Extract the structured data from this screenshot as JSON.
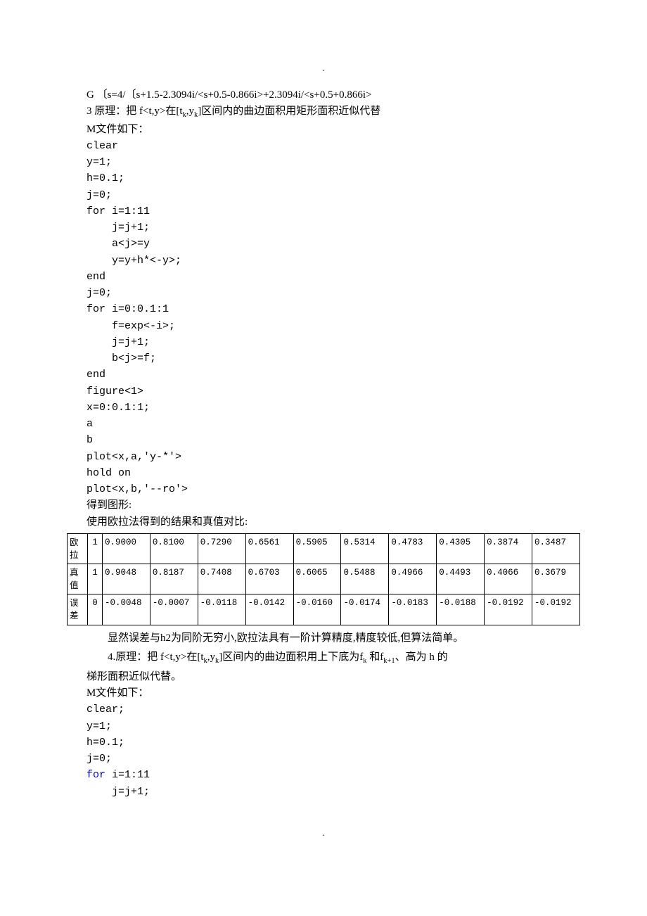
{
  "top_dot": ".",
  "bottom_dot": ".",
  "intro": {
    "formula": "G 〔s=4/〔s+1.5-2.3094i/<s+0.5-0.866i>+2.3094i/<s+0.5+0.866i>",
    "principle_label": "3 原理：把 f<t,y>在[t",
    "principle_sub1": "k",
    "principle_mid": ",y",
    "principle_sub2": "k",
    "principle_tail": "]区间内的曲边面积用矩形面积近似代替",
    "mfile": "M文件如下："
  },
  "code1": [
    "clear",
    "y=1;",
    "h=0.1;",
    "j=0;",
    "for i=1:11",
    "    j=j+1;",
    "    a<j>=y",
    "    y=y+h*<-y>;",
    "end",
    "j=0;",
    "for i=0:0.1:1",
    "    f=exp<-i>;",
    "    j=j+1;",
    "    b<j>=f;",
    "end",
    "figure<1>",
    "x=0:0.1:1;",
    "a",
    "b",
    "plot<x,a,'y-*'>",
    "hold on",
    "plot<x,b,'--ro'>"
  ],
  "after_code1": {
    "l1": "得到图形:",
    "l2": "使用欧拉法得到的结果和真值对比:"
  },
  "table": {
    "rows": [
      {
        "label": "欧拉",
        "first": "1",
        "cells": [
          "0.9000",
          "0.8100",
          "0.7290",
          "0.6561",
          "0.5905",
          "0.5314",
          "0.4783",
          "0.4305",
          "0.3874",
          "0.3487"
        ]
      },
      {
        "label": "真值",
        "first": "1",
        "cells": [
          "0.9048",
          "0.8187",
          "0.7408",
          "0.6703",
          "0.6065",
          "0.5488",
          "0.4966",
          "0.4493",
          "0.4066",
          "0.3679"
        ]
      },
      {
        "label": "误差",
        "first": "0",
        "cells": [
          "-0.0048",
          "-0.0007",
          "-0.0118",
          "-0.0142",
          "-0.0160",
          "-0.0174",
          "-0.0183",
          "-0.0188",
          "-0.0192",
          "-0.0192"
        ]
      }
    ]
  },
  "conclusion": "显然误差与h2为同阶无穷小,欧拉法具有一阶计算精度,精度较低,但算法简单。",
  "sec4": {
    "head_a": "4.原理：把 f<t,y>在[t",
    "sub1": "k",
    "head_b": ",y",
    "sub2": "k",
    "head_c": "]区间内的曲边面积用上下底为f",
    "sub3": "k",
    "head_d": " 和f",
    "sub4": "k+1",
    "head_e": "、高为 h 的",
    "line2": "梯形面积近似代替。",
    "mfile": "M文件如下："
  },
  "code2": {
    "l1": "clear;",
    "l2": "y=1;",
    "l3": "h=0.1;",
    "l4": "j=0;",
    "l5_kw": "for",
    "l5_rest": " i=1:11",
    "l6": "    j=j+1;"
  }
}
